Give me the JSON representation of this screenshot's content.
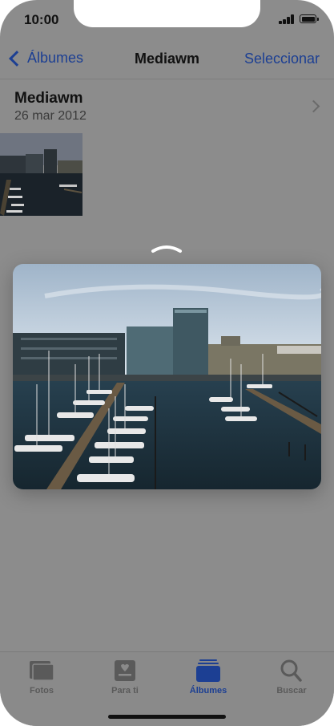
{
  "status_bar": {
    "time": "10:00"
  },
  "nav": {
    "back_label": "Álbumes",
    "title": "Mediawm",
    "select_label": "Seleccionar"
  },
  "album": {
    "name": "Mediawm",
    "date": "26 mar 2012"
  },
  "tabs": [
    {
      "label": "Fotos",
      "icon": "photos-icon",
      "active": false
    },
    {
      "label": "Para ti",
      "icon": "for-you-icon",
      "active": false
    },
    {
      "label": "Álbumes",
      "icon": "albums-icon",
      "active": true
    },
    {
      "label": "Buscar",
      "icon": "search-icon",
      "active": false
    }
  ],
  "colors": {
    "accent": "#1c3f93",
    "dim_background": "#8c8c8c",
    "inactive_tab": "#5a5a5a"
  }
}
